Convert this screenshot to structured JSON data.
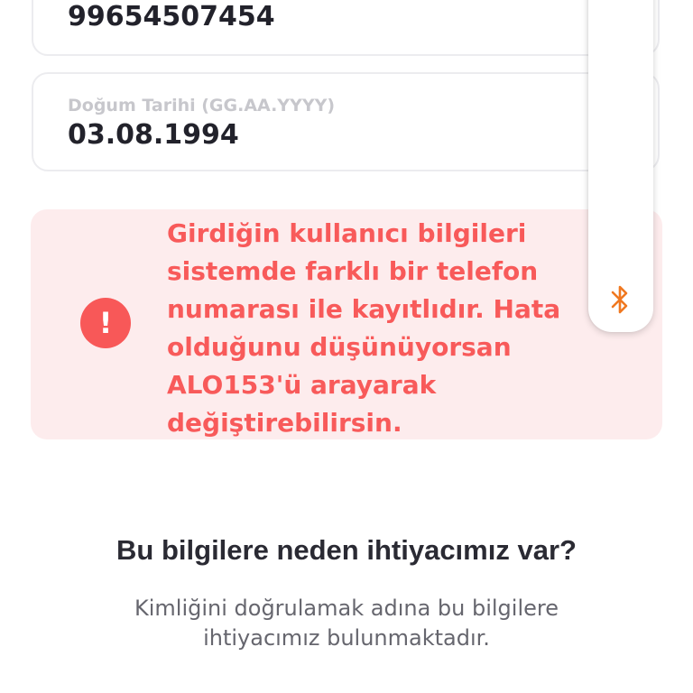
{
  "form": {
    "phone_value": "99654507454",
    "dob_label": "Doğum Tarihi (GG.AA.YYYY)",
    "dob_value": "03.08.1994"
  },
  "error": {
    "icon": "exclamation-icon",
    "message": "Girdiğin kullanıcı bilgileri sistemde farklı bir telefon numarası ile kayıtlıdır.  Hata olduğunu düşünüyorsan ALO153'ü arayarak değiştirebilirsin."
  },
  "side_panel": {
    "icon": "bluetooth-icon"
  },
  "info": {
    "title": "Bu bilgilere neden ihtiyacımız var?",
    "description": "Kimliğini doğrulamak adına bu bilgilere ihtiyacımız bulunmaktadır."
  },
  "colors": {
    "error_text": "#f85a5a",
    "error_bg": "#fdeced",
    "error_icon_bg": "#f85858",
    "bluetooth": "#f07820"
  }
}
